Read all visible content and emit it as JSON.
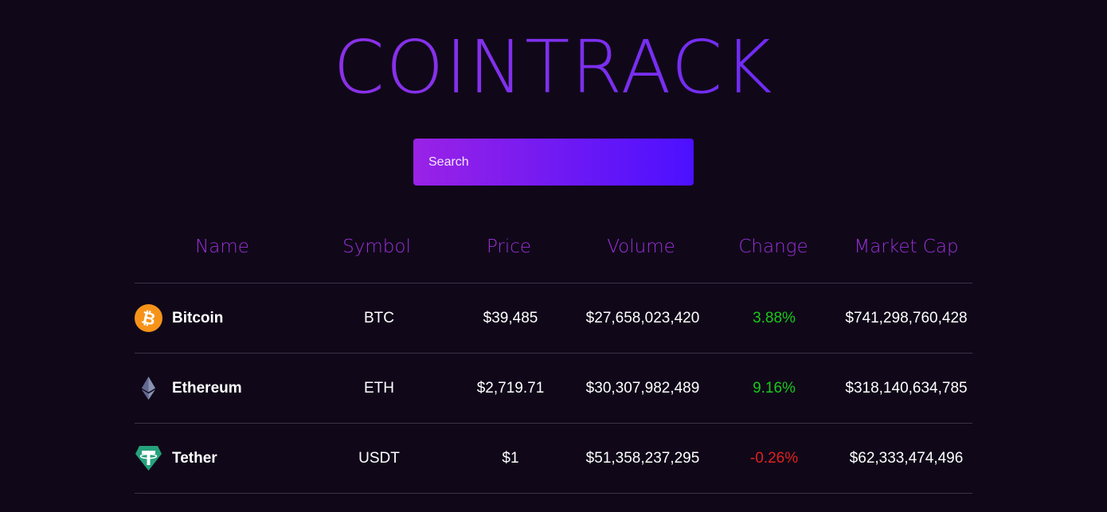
{
  "app": {
    "logo": "COINTRACK"
  },
  "search": {
    "placeholder": "Search",
    "value": ""
  },
  "table": {
    "headers": {
      "name": "Name",
      "symbol": "Symbol",
      "price": "Price",
      "volume": "Volume",
      "change": "Change",
      "market_cap": "Market Cap"
    },
    "rows": [
      {
        "icon": "bitcoin-icon",
        "name": "Bitcoin",
        "symbol": "BTC",
        "price": "$39,485",
        "volume": "$27,658,023,420",
        "change": "3.88%",
        "change_direction": "up",
        "market_cap": "$741,298,760,428"
      },
      {
        "icon": "ethereum-icon",
        "name": "Ethereum",
        "symbol": "ETH",
        "price": "$2,719.71",
        "volume": "$30,307,982,489",
        "change": "9.16%",
        "change_direction": "up",
        "market_cap": "$318,140,634,785"
      },
      {
        "icon": "tether-icon",
        "name": "Tether",
        "symbol": "USDT",
        "price": "$1",
        "volume": "$51,358,237,295",
        "change": "-0.26%",
        "change_direction": "down",
        "market_cap": "$62,333,474,496"
      }
    ]
  },
  "colors": {
    "background": "#100819",
    "accent_purple": "#9a30d8",
    "positive": "#19c919",
    "negative": "#e0211d",
    "divider": "#3a3346"
  }
}
